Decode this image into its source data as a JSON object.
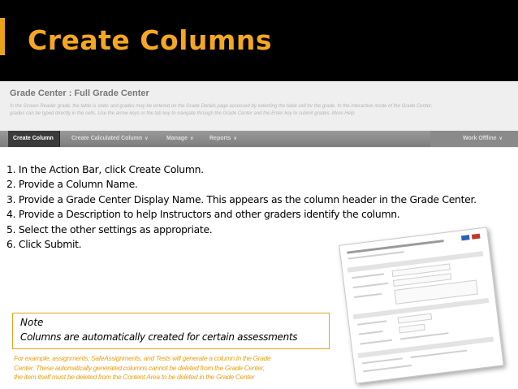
{
  "slide": {
    "title": "Create Columns",
    "accent_color": "#f5a623"
  },
  "grade_center": {
    "title": "Grade Center : Full Grade Center",
    "description_lines": [
      "In the Screen Reader grade, the table is static and grades may be entered on the Grade Details page accessed by selecting the table cell for the grade. In the interactive mode of the Grade Center,",
      "grades can be typed directly in the cells. Use the arrow keys or the tab key to navigate through the Grade Center and the Enter key to submit grades. More Help"
    ],
    "action_bar": {
      "create_column": "Create Column",
      "create_calculated_column": "Create Calculated Column",
      "manage": "Manage",
      "reports": "Reports",
      "work_offline": "Work Offline"
    }
  },
  "steps": [
    "1. In the Action Bar, click Create Column.",
    "2. Provide a Column Name.",
    "3. Provide a Grade Center Display Name. This appears as the column header in the Grade Center.",
    "4. Provide a Description to help Instructors and other graders identify the column.",
    "5. Select the other settings as appropriate.",
    "6. Click Submit."
  ],
  "note": {
    "title": "Note",
    "text": "Columns are automatically created for certain assessments"
  },
  "example_lines": [
    "For example, assignments, SafeAssignments, and Tests will generate a column in the Grade",
    "Center. These automatically generated columns cannot be deleted from the Grade Center,",
    "the item itself must be deleted from the Content Area to be deleted in the Grade Center"
  ]
}
